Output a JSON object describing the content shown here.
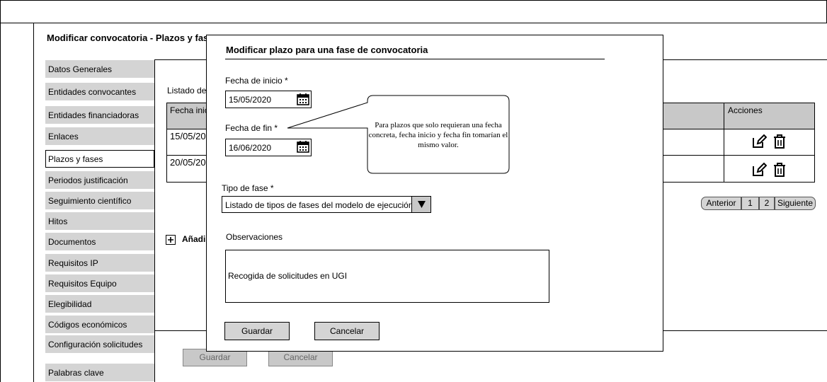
{
  "page": {
    "title": "Modificar convocatoria - Plazos y fases"
  },
  "sidebar": {
    "items": [
      {
        "label": "Datos Generales"
      },
      {
        "label": "Entidades convocantes"
      },
      {
        "label": "Entidades financiadoras"
      },
      {
        "label": "Enlaces"
      },
      {
        "label": "Plazos y fases"
      },
      {
        "label": "Periodos justificación"
      },
      {
        "label": "Seguimiento científico"
      },
      {
        "label": "Hitos"
      },
      {
        "label": "Documentos"
      },
      {
        "label": "Requisitos IP"
      },
      {
        "label": "Requisitos Equipo"
      },
      {
        "label": "Elegibilidad"
      },
      {
        "label": "Códigos económicos"
      },
      {
        "label": "Configuración solicitudes"
      },
      {
        "label": "Palabras clave"
      }
    ],
    "active_index": 4
  },
  "main": {
    "list_label": "Listado de",
    "table": {
      "headers": {
        "first": "Fecha inic",
        "actions": "Acciones"
      },
      "rows": [
        {
          "fecha_inicio": "15/05/20"
        },
        {
          "fecha_inicio": "20/05/20"
        }
      ],
      "row_actions": [
        "edit-icon",
        "delete-icon"
      ]
    },
    "pagination": {
      "prev": "Anterior",
      "pages": [
        "1",
        "2"
      ],
      "next": "Siguiente"
    },
    "add_label": "Añadir",
    "footer": {
      "save": "Guardar",
      "cancel": "Cancelar"
    }
  },
  "modal": {
    "title": "Modificar plazo para una fase de convocatoria",
    "fecha_inicio": {
      "label": "Fecha de inicio *",
      "value": "15/05/2020"
    },
    "fecha_fin": {
      "label": "Fecha de fin *",
      "value": "16/06/2020"
    },
    "callout": "Para plazos que solo requieran una fecha concreta, fecha inicio y fecha fin tomarían el mismo valor.",
    "tipo_fase": {
      "label": "Tipo de fase *",
      "value": "Listado de tipos de fases del modelo de ejecución"
    },
    "observaciones": {
      "label": "Observaciones",
      "value": "Recogida de solicitudes en UGI"
    },
    "buttons": {
      "save": "Guardar",
      "cancel": "Cancelar"
    }
  }
}
